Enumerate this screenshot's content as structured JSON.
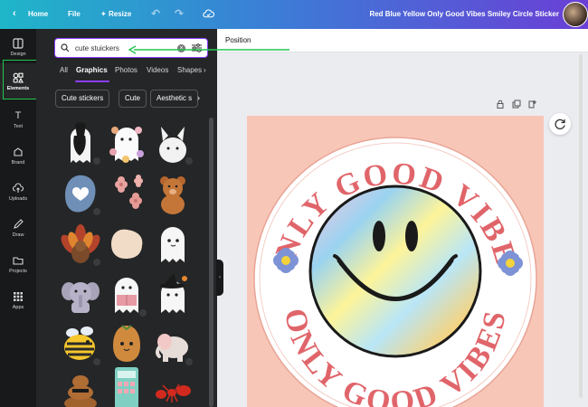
{
  "topbar": {
    "home_label": "Home",
    "file_label": "File",
    "resize_label": "Resize",
    "title": "Red Blue Yellow Only Good Vibes Smiley Circle Sticker"
  },
  "rail": {
    "items": [
      {
        "label": "Design",
        "icon": "design-icon"
      },
      {
        "label": "Elements",
        "icon": "elements-icon"
      },
      {
        "label": "Text",
        "icon": "text-icon"
      },
      {
        "label": "Brand",
        "icon": "brand-icon"
      },
      {
        "label": "Uploads",
        "icon": "uploads-icon"
      },
      {
        "label": "Draw",
        "icon": "draw-icon"
      },
      {
        "label": "Projects",
        "icon": "projects-icon"
      },
      {
        "label": "Apps",
        "icon": "apps-icon"
      }
    ]
  },
  "panel": {
    "search_value": "cute stuickers",
    "tabs": [
      "All",
      "Graphics",
      "Photos",
      "Videos",
      "Shapes"
    ],
    "chips": [
      "Cute stickers",
      "Cute",
      "Aesthetic s"
    ]
  },
  "main": {
    "position_label": "Position"
  },
  "sticker": {
    "text_top": "ONLY GOOD VIBES",
    "text_bottom": "ONLY GOOD VIBES"
  },
  "colors": {
    "accent": "#8b3dff",
    "highlight": "#23c552",
    "sticker_bg": "#f8c6b7",
    "sticker_text": "#e0656a"
  }
}
